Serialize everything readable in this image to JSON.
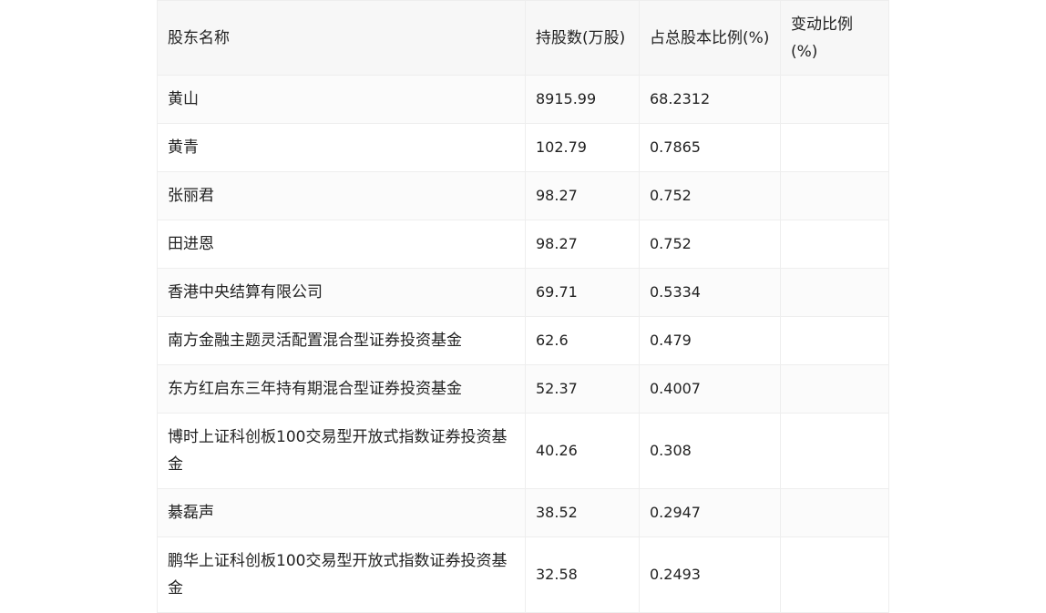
{
  "table": {
    "headers": [
      "股东名称",
      "持股数(万股)",
      "占总股本比例(%)",
      "变动比例(%)"
    ],
    "rows": [
      {
        "name": "黄山",
        "shares": "8915.99",
        "ratio": "68.2312",
        "change": ""
      },
      {
        "name": "黄青",
        "shares": "102.79",
        "ratio": "0.7865",
        "change": ""
      },
      {
        "name": "张丽君",
        "shares": "98.27",
        "ratio": "0.752",
        "change": ""
      },
      {
        "name": "田进恩",
        "shares": "98.27",
        "ratio": "0.752",
        "change": ""
      },
      {
        "name": "香港中央结算有限公司",
        "shares": "69.71",
        "ratio": "0.5334",
        "change": ""
      },
      {
        "name": "南方金融主题灵活配置混合型证券投资基金",
        "shares": "62.6",
        "ratio": "0.479",
        "change": ""
      },
      {
        "name": "东方红启东三年持有期混合型证券投资基金",
        "shares": "52.37",
        "ratio": "0.4007",
        "change": ""
      },
      {
        "name": "博时上证科创板100交易型开放式指数证券投资基金",
        "shares": "40.26",
        "ratio": "0.308",
        "change": ""
      },
      {
        "name": "綦磊声",
        "shares": "38.52",
        "ratio": "0.2947",
        "change": ""
      },
      {
        "name": "鹏华上证科创板100交易型开放式指数证券投资基金",
        "shares": "32.58",
        "ratio": "0.2493",
        "change": ""
      }
    ]
  }
}
